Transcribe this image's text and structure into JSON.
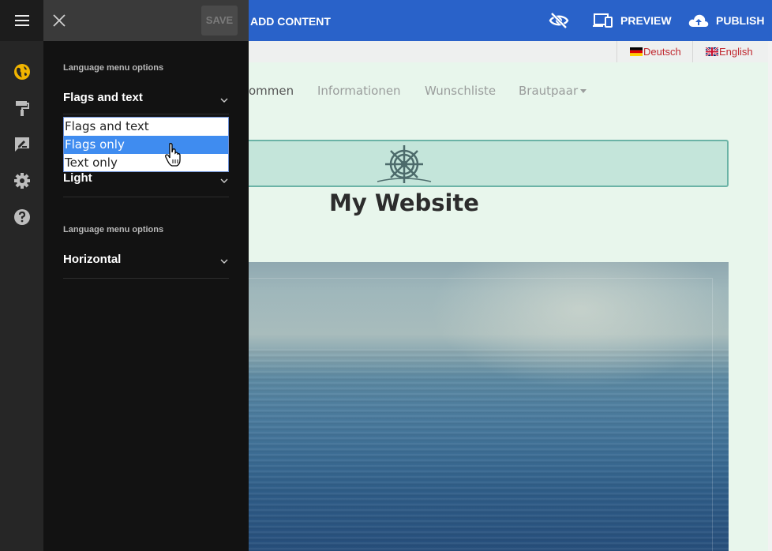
{
  "toolbar": {
    "add_content": "ADD CONTENT",
    "preview": "PREVIEW",
    "publish": "PUBLISH",
    "save": "SAVE",
    "color": "#2962c9"
  },
  "site": {
    "languages": [
      {
        "label": "Deutsch",
        "flag": "de-flag-icon"
      },
      {
        "label": "English",
        "flag": "uk-flag-icon"
      }
    ],
    "nav": [
      "ommen",
      "Informationen",
      "Wunschliste",
      "Brautpaar"
    ],
    "title": "My Website"
  },
  "panel": {
    "section1_label": "Language menu options",
    "section1_value": "Flags and text",
    "options": [
      "Flags and text",
      "Flags only",
      "Text only"
    ],
    "selected_option": "Flags only",
    "row2_value": "Light",
    "section2_label": "Language menu options",
    "section2_value": "Horizontal"
  },
  "icons": [
    "menu-icon",
    "close-icon",
    "globe-icon",
    "paint-roller-icon",
    "edit-icon",
    "gear-icon",
    "help-icon",
    "eye-off-icon",
    "devices-icon",
    "cloud-upload-icon",
    "chevron-down-icon",
    "ship-wheel-icon",
    "hand-pointer-icon"
  ]
}
